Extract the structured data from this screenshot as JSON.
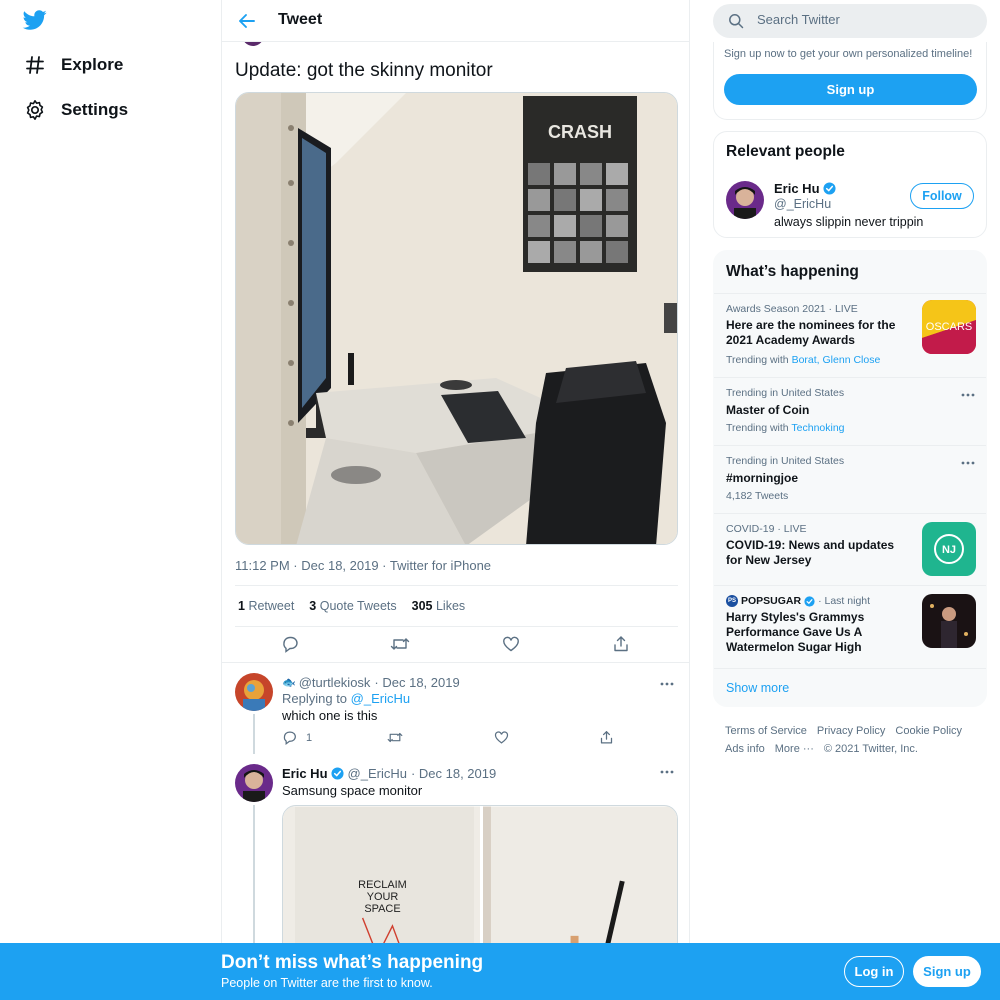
{
  "nav": {
    "logo_icon": "twitter-bird-icon",
    "items": [
      {
        "label": "Explore",
        "icon": "hashtag-icon"
      },
      {
        "label": "Settings",
        "icon": "gear-icon"
      }
    ]
  },
  "header": {
    "title": "Tweet",
    "back_icon": "arrow-left-icon"
  },
  "tweet": {
    "text": "Update: got the skinny monitor",
    "photo_poster_title": "CRASH",
    "meta": "11:12 PM · Dec 18, 2019 · Twitter for iPhone",
    "stats": {
      "retweets_count": "1",
      "retweets_label": "Retweet",
      "quotes_count": "3",
      "quotes_label": "Quote Tweets",
      "likes_count": "305",
      "likes_label": "Likes"
    },
    "action_icons": [
      "reply-icon",
      "retweet-icon",
      "like-icon",
      "share-icon"
    ]
  },
  "replies": [
    {
      "emoji": "🐟",
      "handle": "@turtlekiosk",
      "date": "· Dec 18, 2019",
      "replying_prefix": "Replying to",
      "replying_to": "@_EricHu",
      "text": "which one is this",
      "reply_count": "1"
    },
    {
      "name": "Eric Hu",
      "handle": "@_EricHu",
      "date": "· Dec 18, 2019",
      "text": "Samsung space monitor",
      "media_poster_text": [
        "RECLAIM",
        "YOUR",
        "SPACE"
      ]
    }
  ],
  "search": {
    "placeholder": "Search Twitter"
  },
  "signup_card": {
    "text": "Sign up now to get your own personalized timeline!",
    "button": "Sign up"
  },
  "relevant": {
    "title": "Relevant people",
    "name": "Eric Hu",
    "handle": "@_EricHu",
    "bio": "always slippin never trippin",
    "follow": "Follow"
  },
  "happening": {
    "title": "What’s happening",
    "trends": [
      {
        "context": "Awards Season 2021 · LIVE",
        "title": "Here are the nominees for the 2021 Academy Awards",
        "sub_prefix": "Trending with",
        "sub_links": "Borat, Glenn Close",
        "thumb_text": "OSCARS"
      },
      {
        "context": "Trending in United States",
        "title": "Master of Coin",
        "sub_prefix": "Trending with",
        "sub_links": "Technoking"
      },
      {
        "context": "Trending in United States",
        "title": "#morningjoe",
        "sub": "4,182 Tweets"
      },
      {
        "context": "COVID-19 · LIVE",
        "title": "COVID-19: News and updates for New Jersey",
        "thumb_text": "NJ"
      },
      {
        "context_badge": "PS",
        "context_name": "POPSUGAR",
        "context_tail": "· Last night",
        "title": "Harry Styles's Grammys Performance Gave Us A Watermelon Sugar High"
      }
    ],
    "show_more": "Show more"
  },
  "footer": {
    "links": [
      "Terms of Service",
      "Privacy Policy",
      "Cookie Policy",
      "Ads info",
      "More ···"
    ],
    "copyright": "© 2021 Twitter, Inc."
  },
  "bottom_bar": {
    "title": "Don’t miss what’s happening",
    "subtitle": "People on Twitter are the first to know.",
    "login": "Log in",
    "signup": "Sign up"
  },
  "colors": {
    "accent": "#1da1f2",
    "text": "#0f1419",
    "muted": "#5b7083",
    "border": "#ebeef0"
  }
}
